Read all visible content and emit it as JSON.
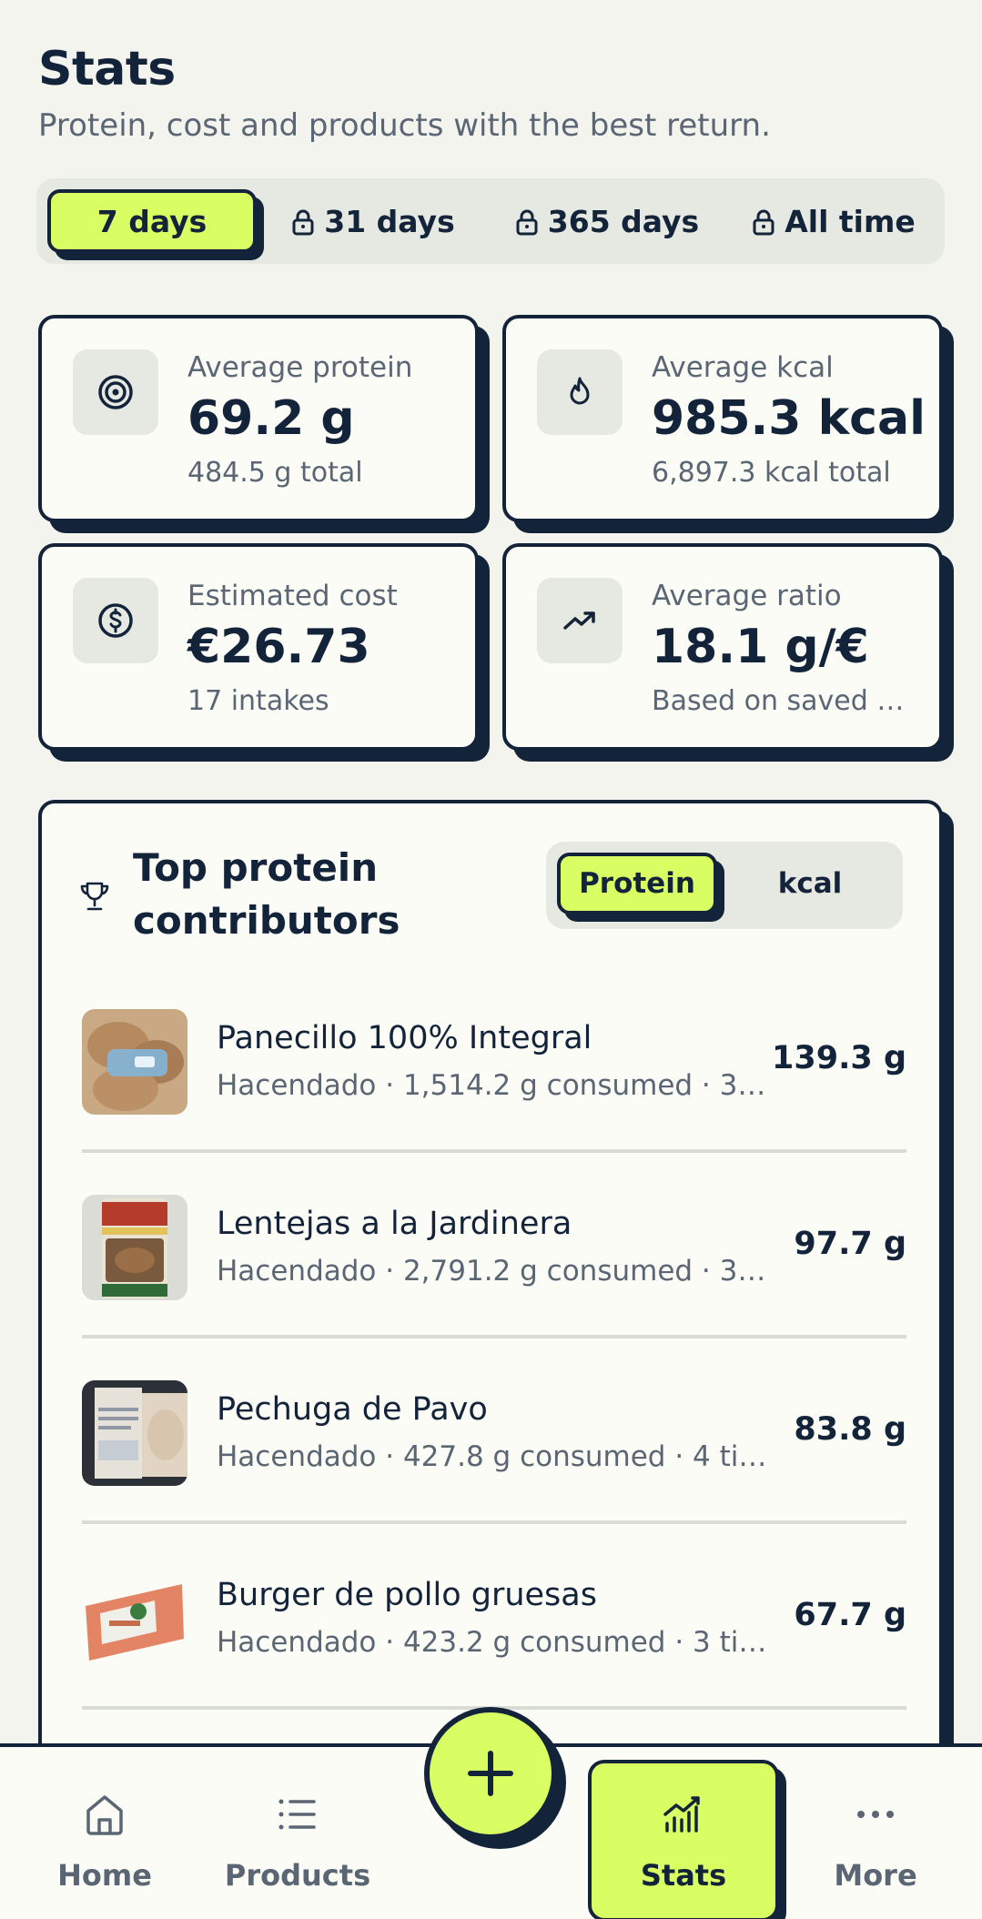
{
  "header": {
    "title": "Stats",
    "subtitle": "Protein, cost and products with the best return."
  },
  "range": {
    "tabs": [
      {
        "label": "7 days",
        "active": true,
        "locked": false
      },
      {
        "label": "31 days",
        "active": false,
        "locked": true
      },
      {
        "label": "365 days",
        "active": false,
        "locked": true
      },
      {
        "label": "All time",
        "active": false,
        "locked": true
      }
    ]
  },
  "metrics": [
    {
      "icon": "target-icon",
      "label": "Average protein",
      "value": "69.2 g",
      "sub": "484.5 g total"
    },
    {
      "icon": "flame-icon",
      "label": "Average kcal",
      "value": "985.3 kcal",
      "sub": "6,897.3 kcal total"
    },
    {
      "icon": "dollar-icon",
      "label": "Estimated cost",
      "value": "€26.73",
      "sub": "17 intakes"
    },
    {
      "icon": "trending-up-icon",
      "label": "Average ratio",
      "value": "18.1 g/€",
      "sub": "Based on saved …"
    }
  ],
  "contributors": {
    "title": "Top protein contributors",
    "toggle": {
      "protein": "Protein",
      "kcal": "kcal",
      "active": "protein"
    },
    "items": [
      {
        "name": "Panecillo 100% Integral",
        "meta": "Hacendado · 1,514.2 g consumed · 3 t…",
        "value": "139.3 g",
        "thumb_color": "#b98f6a"
      },
      {
        "name": "Lentejas a la Jardinera",
        "meta": "Hacendado · 2,791.2 g consumed · 3 ti…",
        "value": "97.7 g",
        "thumb_color": "#8e6a4a"
      },
      {
        "name": "Pechuga de Pavo",
        "meta": "Hacendado · 427.8 g consumed · 4 times",
        "value": "83.8 g",
        "thumb_color": "#d8cbbb"
      },
      {
        "name": "Burger de pollo gruesas",
        "meta": "Hacendado · 423.2 g consumed · 3 tim…",
        "value": "67.7 g",
        "thumb_color": "#e0896a"
      }
    ]
  },
  "nav": {
    "items": [
      {
        "label": "Home",
        "icon": "home-icon"
      },
      {
        "label": "Products",
        "icon": "list-icon"
      },
      {
        "label": "Stats",
        "icon": "bar-chart-icon",
        "active": true
      },
      {
        "label": "More",
        "icon": "more-icon"
      }
    ],
    "fab_icon": "plus-icon"
  },
  "colors": {
    "accent": "#d9fe64",
    "ink": "#13233a",
    "background": "#f4f4ee"
  }
}
